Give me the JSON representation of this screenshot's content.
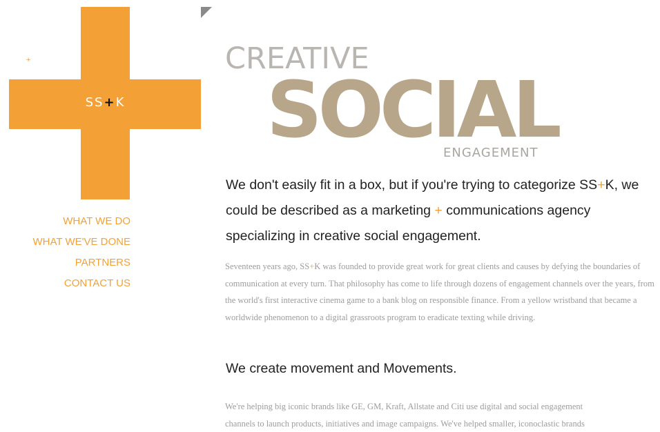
{
  "logo": {
    "text_before": "SS",
    "plus": "+",
    "text_after": "K",
    "small_plus": "+"
  },
  "nav": {
    "items": [
      "WHAT WE DO",
      "WHAT WE'VE DONE",
      "PARTNERS",
      "CONTACT US"
    ]
  },
  "header": {
    "creative": "CREATIVE",
    "social": "SOCIAL",
    "engagement": "ENGAGEMENT"
  },
  "lede": {
    "part1": "We don't easily fit in a box, but if you're trying to categorize SS",
    "plus1": "+",
    "part2": "K, we could be described as a marketing ",
    "plus2": "+",
    "part3": " communications agency specializing in creative social engagement."
  },
  "paragraph1": {
    "part1": "Seventeen years ago, SS",
    "plus": "+",
    "part2": "K was founded to provide great work for great clients and causes by defying the boundaries of communication at every turn. That philosophy has come to life through dozens of engagement channels over the years, from the world's first interactive cinema game to a bank blog on responsible finance. From a yellow wristband that became a worldwide phenomenon to a digital grassroots program to eradicate texting while driving."
  },
  "heading2": "We create movement and Movements.",
  "paragraph2": {
    "line1": "We're helping big iconic brands like GE, GM, Kraft, Allstate and Citi use digital and social engagement",
    "line2": "channels to launch products, initiatives and image campaigns. We've helped smaller, iconoclastic brands"
  },
  "colors": {
    "accent": "#f3a136",
    "social": "#b8a68a",
    "creative": "#b9b6b2",
    "body_text": "#9c9c9c",
    "heading_text": "#222222"
  }
}
